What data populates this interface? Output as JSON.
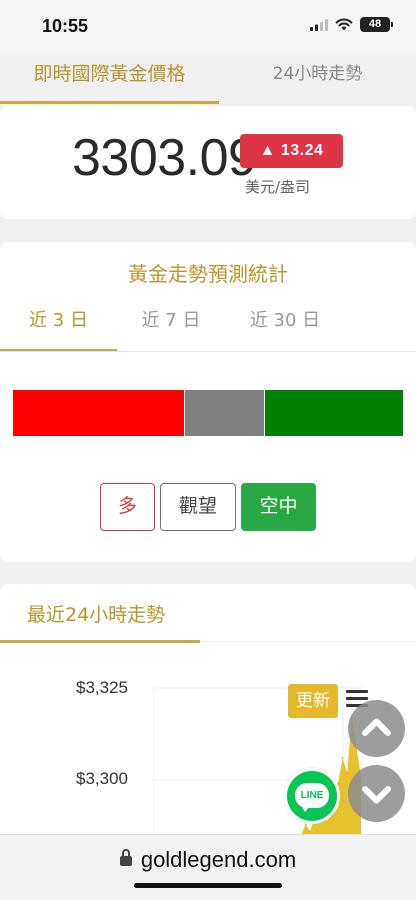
{
  "status_bar": {
    "time": "10:55",
    "battery": "48",
    "icons": [
      "cellular-signal-icon",
      "wifi-icon",
      "battery-icon"
    ]
  },
  "top_tabs": {
    "realtime": "即時國際黃金價格",
    "trend24": "24小時走勢"
  },
  "price": {
    "value": "3303.09",
    "change": "▲ 13.24",
    "unit": "美元/盎司",
    "change_color": "#dc3545"
  },
  "forecast": {
    "title": "黃金走勢預測統計",
    "tabs": [
      "近 3 日",
      "近 7 日",
      "近 30 日"
    ],
    "active_tab": 0,
    "distribution": [
      {
        "name": "多",
        "fraction": 0.44,
        "color": "#ff0000"
      },
      {
        "name": "觀望",
        "fraction": 0.205,
        "color": "#808080"
      },
      {
        "name": "空中",
        "fraction": 0.355,
        "color": "#008000"
      }
    ],
    "buttons": {
      "long": "多",
      "hold": "觀望",
      "short": "空中"
    }
  },
  "trend": {
    "title": "最近24小時走勢",
    "y_ticks": [
      "$3,325",
      "$3,300"
    ],
    "refresh_label": "更新"
  },
  "chart_data": {
    "type": "area",
    "y_tick_labels": [
      "$3,325",
      "$3,300"
    ],
    "values": [
      3275,
      3276,
      3277,
      3279,
      3282,
      3285,
      3288,
      3286,
      3290,
      3289,
      3292,
      3291,
      3296,
      3299,
      3306,
      3302,
      3317,
      3309,
      3301
    ],
    "color": "#e8c22e"
  },
  "floating": {
    "line_label": "LINE"
  },
  "browser": {
    "url": "goldlegend.com"
  }
}
